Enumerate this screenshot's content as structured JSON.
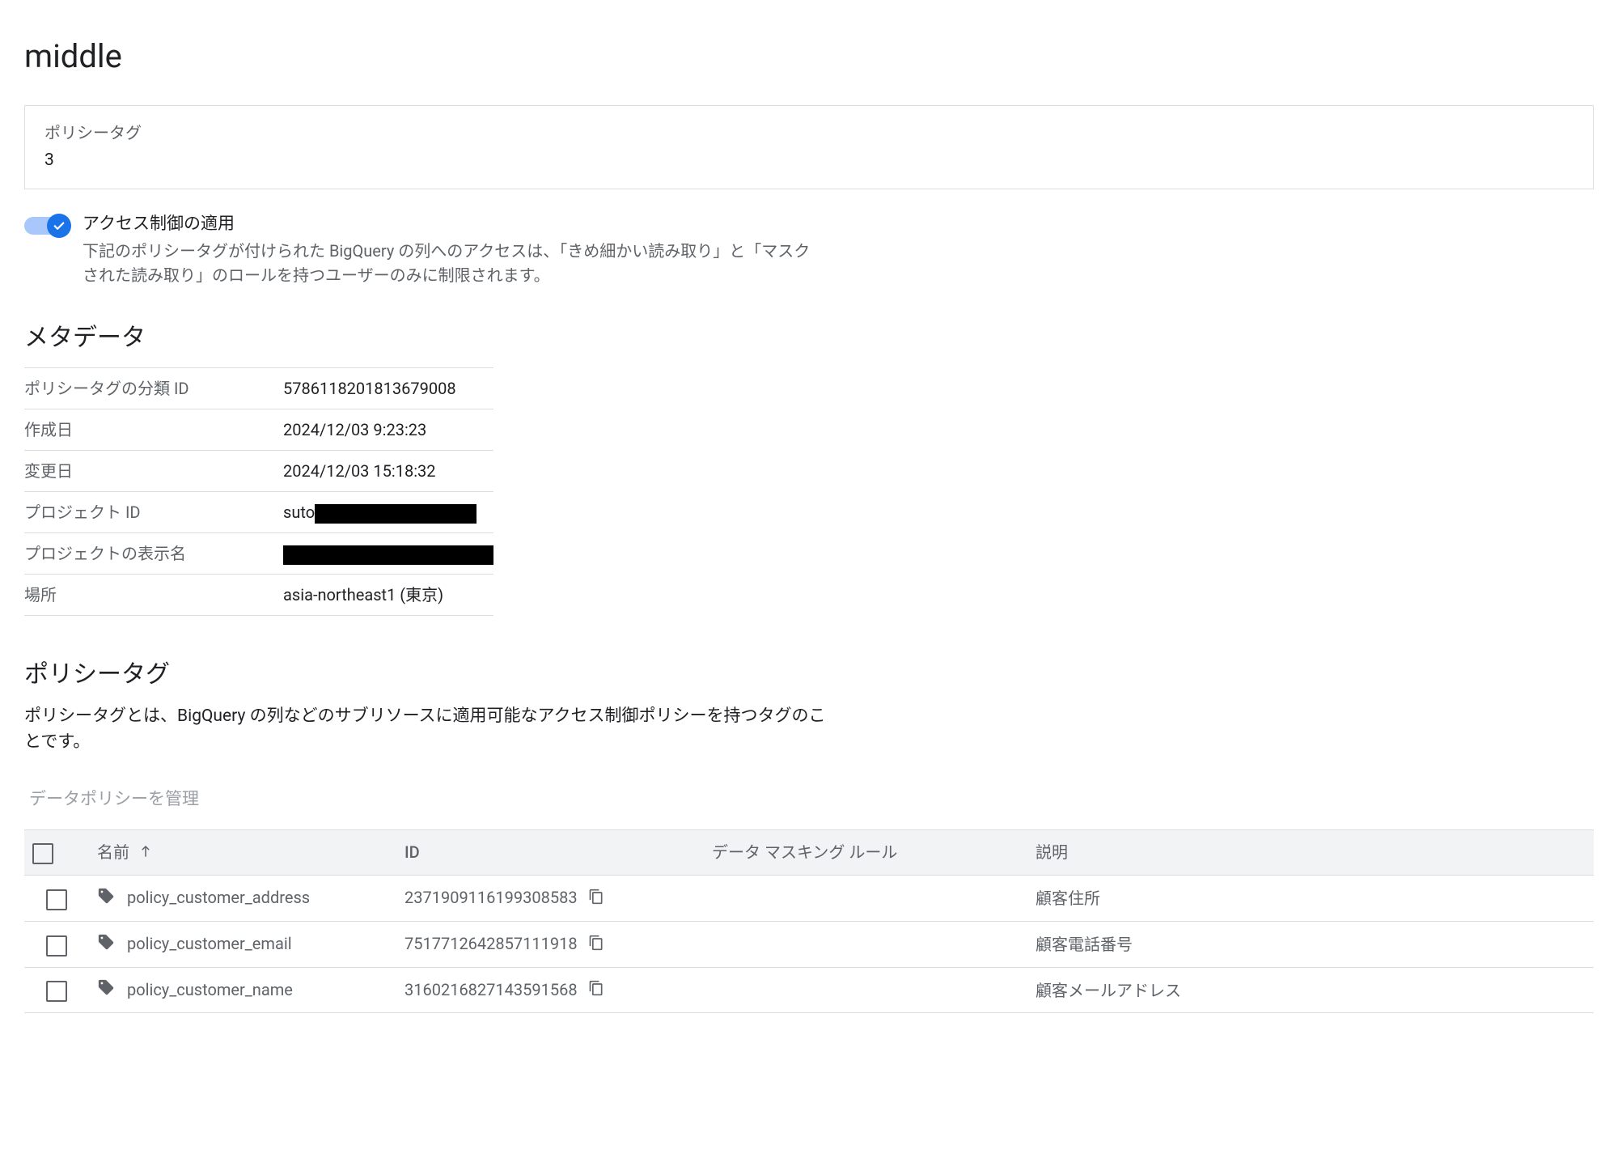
{
  "page": {
    "title": "middle"
  },
  "summary_card": {
    "label": "ポリシータグ",
    "count": "3"
  },
  "access_control": {
    "enabled": true,
    "title": "アクセス制御の適用",
    "description": "下記のポリシータグが付けられた BigQuery の列へのアクセスは、「きめ細かい読み取り」と「マスクされた読み取り」のロールを持つユーザーのみに制限されます。"
  },
  "metadata": {
    "section_title": "メタデータ",
    "rows": [
      {
        "label": "ポリシータグの分類 ID",
        "value": "5786118201813679008"
      },
      {
        "label": "作成日",
        "value": "2024/12/03 9:23:23"
      },
      {
        "label": "変更日",
        "value": "2024/12/03 15:18:32"
      },
      {
        "label": "プロジェクト ID",
        "value_prefix": "suto",
        "redacted": true
      },
      {
        "label": "プロジェクトの表示名",
        "value_prefix": "",
        "redacted": true
      },
      {
        "label": "場所",
        "value": "asia-northeast1 (東京)"
      }
    ]
  },
  "policy_tags": {
    "section_title": "ポリシータグ",
    "description": "ポリシータグとは、BigQuery の列などのサブリソースに適用可能なアクセス制御ポリシーを持つタグのことです。",
    "manage_link": "データポリシーを管理",
    "columns": {
      "name": "名前",
      "id": "ID",
      "masking_rule": "データ マスキング ルール",
      "description": "説明"
    },
    "sort": {
      "column": "name",
      "direction": "asc"
    },
    "rows": [
      {
        "name": "policy_customer_address",
        "id": "2371909116199308583",
        "masking_rule": "",
        "description": "顧客住所"
      },
      {
        "name": "policy_customer_email",
        "id": "7517712642857111918",
        "masking_rule": "",
        "description": "顧客電話番号"
      },
      {
        "name": "policy_customer_name",
        "id": "3160216827143591568",
        "masking_rule": "",
        "description": "顧客メールアドレス"
      }
    ]
  }
}
